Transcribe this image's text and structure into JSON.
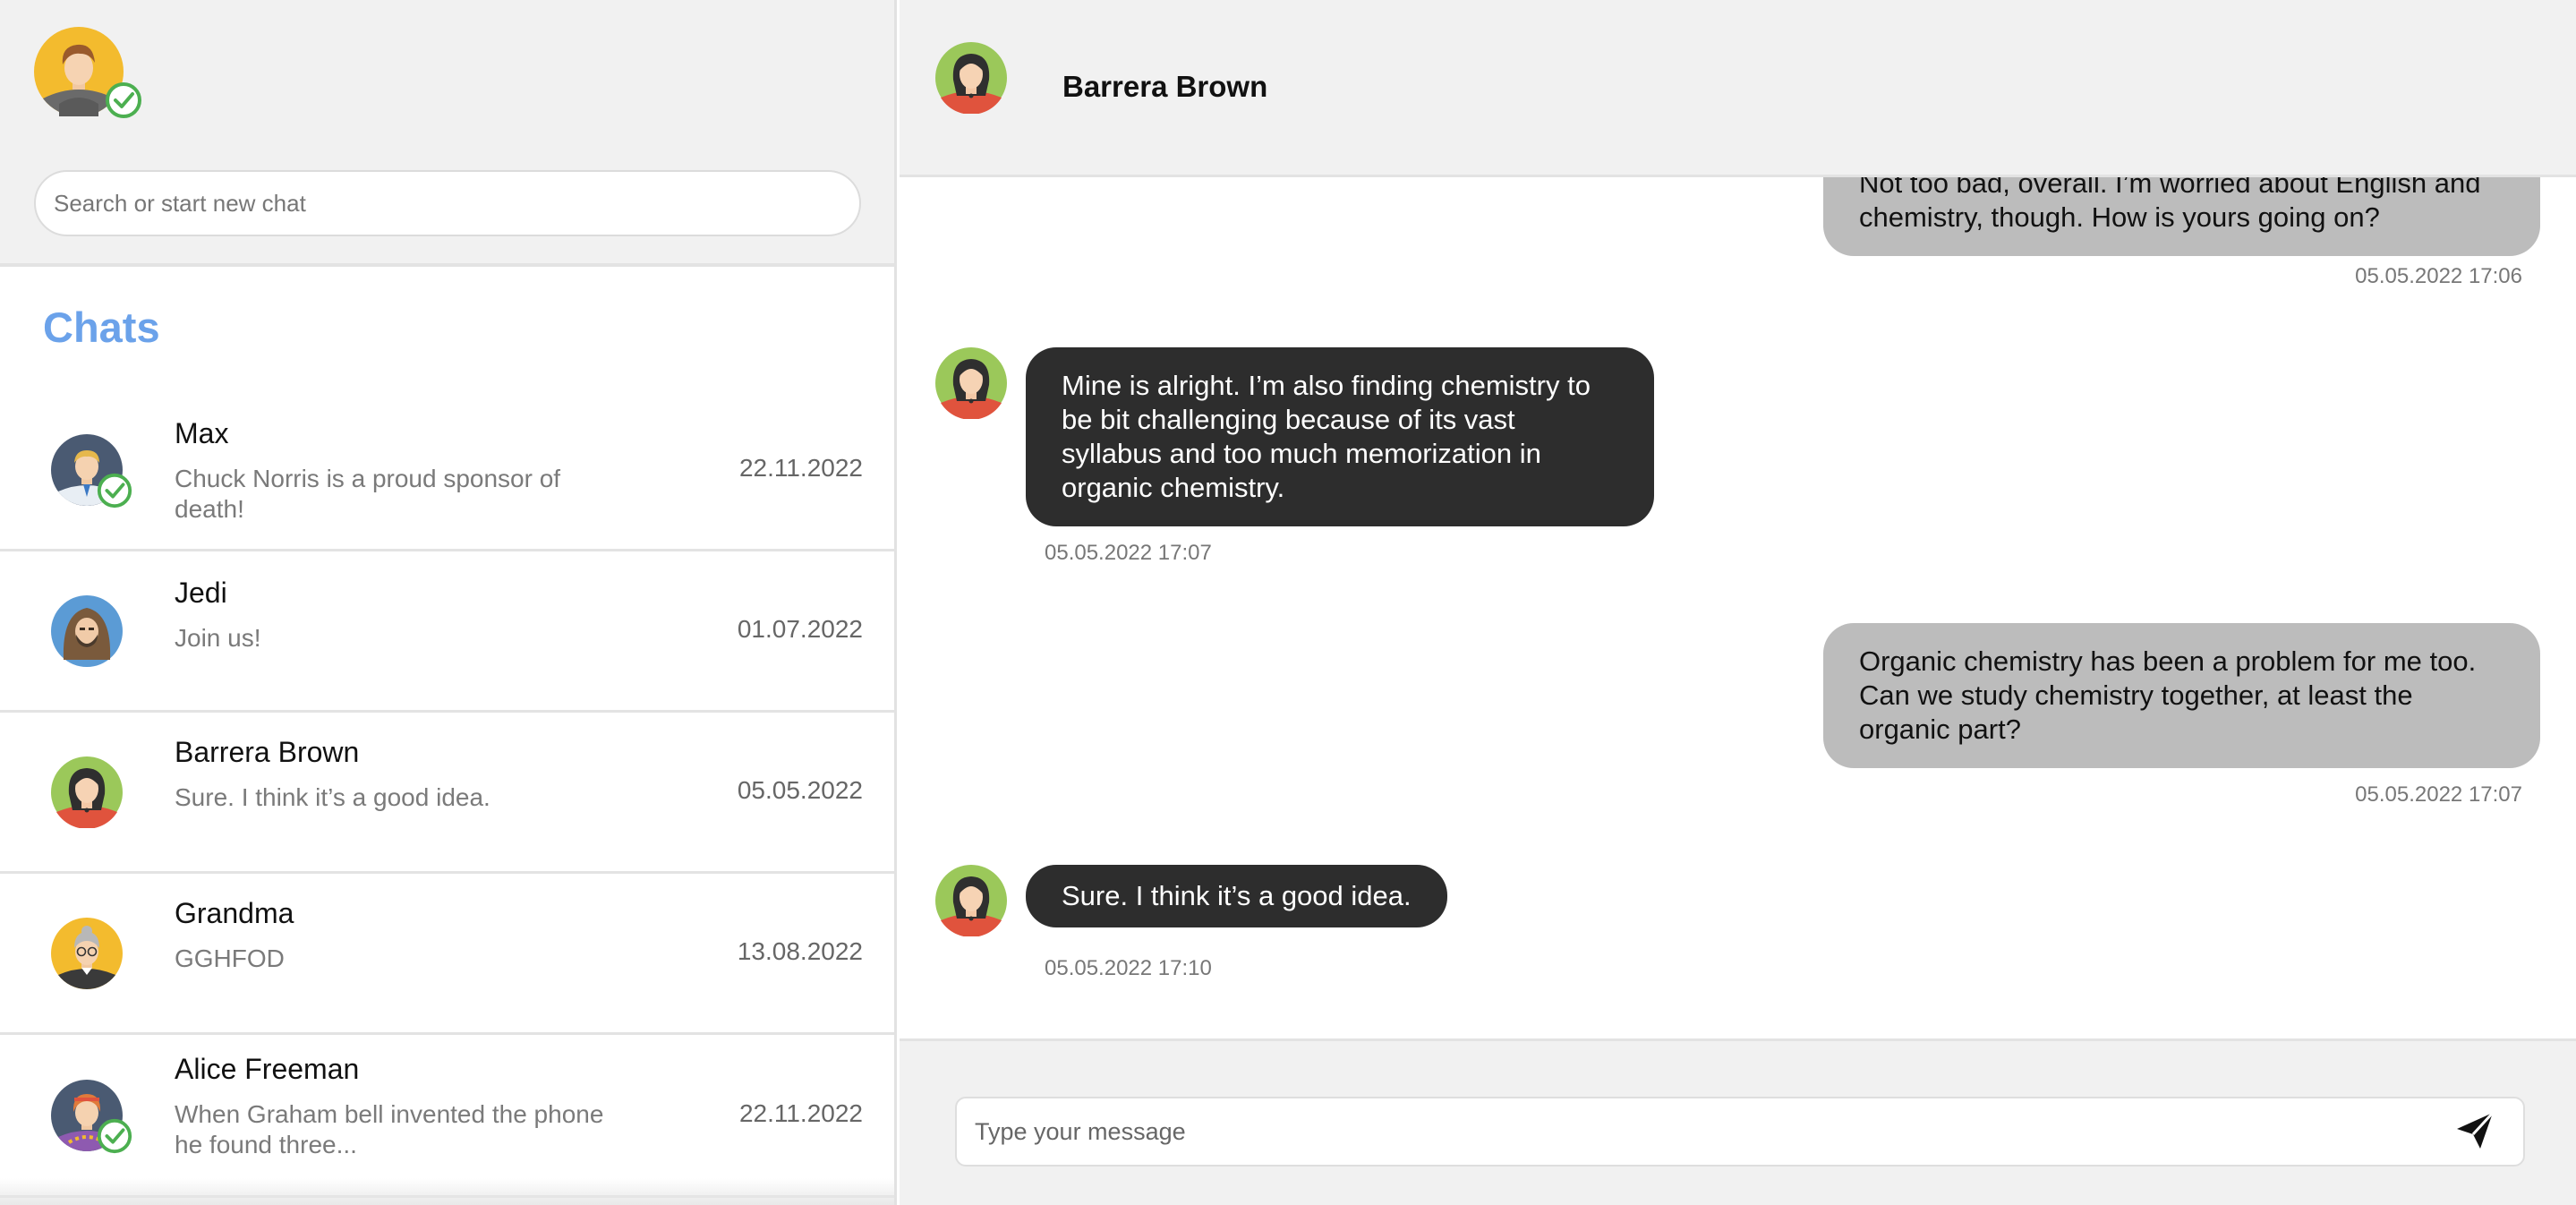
{
  "sidebar": {
    "search_placeholder": "Search or start new chat",
    "chats_title": "Chats",
    "accent_color": "#6ba2ea",
    "chats": [
      {
        "name": "Max",
        "preview": "Chuck Norris is a proud sponsor of death!",
        "date": "22.11.2022",
        "online": true,
        "avatar": "man-blond-avatar-icon"
      },
      {
        "name": "Jedi",
        "preview": "Join us!",
        "date": "01.07.2022",
        "online": false,
        "avatar": "hooded-man-avatar-icon"
      },
      {
        "name": "Barrera Brown",
        "preview": "Sure. I think it’s a good idea.",
        "date": "05.05.2022",
        "online": false,
        "avatar": "woman-avatar-icon"
      },
      {
        "name": "Grandma",
        "preview": "GGHFOD",
        "date": "13.08.2022",
        "online": false,
        "avatar": "grandma-avatar-icon"
      },
      {
        "name": "Alice Freeman",
        "preview": "When Graham bell invented the phone he found three...",
        "date": "22.11.2022",
        "online": true,
        "avatar": "woman-redhead-avatar-icon"
      }
    ]
  },
  "conversation": {
    "contact_name": "Barrera Brown",
    "messages": [
      {
        "direction": "out",
        "text": "Not too bad, overall. I’m worried about English and chemistry, though. How is yours going on?",
        "time": "05.05.2022 17:06"
      },
      {
        "direction": "in",
        "text": "Mine is alright. I’m also finding chemistry to be bit challenging because of its vast syllabus and too much memorization in organic chemistry.",
        "time": "05.05.2022 17:07"
      },
      {
        "direction": "out",
        "text": "Organic chemistry has been a problem for me too. Can we study chemistry together, at least the organic part?",
        "time": "05.05.2022 17:07"
      },
      {
        "direction": "in",
        "text": "Sure. I think it’s a good idea.",
        "time": "05.05.2022 17:10"
      }
    ],
    "composer_placeholder": "Type your message"
  },
  "colors": {
    "incoming_bubble": "#2d2d2d",
    "outgoing_bubble": "#bcbcbc",
    "online_check": "#4caf50"
  }
}
